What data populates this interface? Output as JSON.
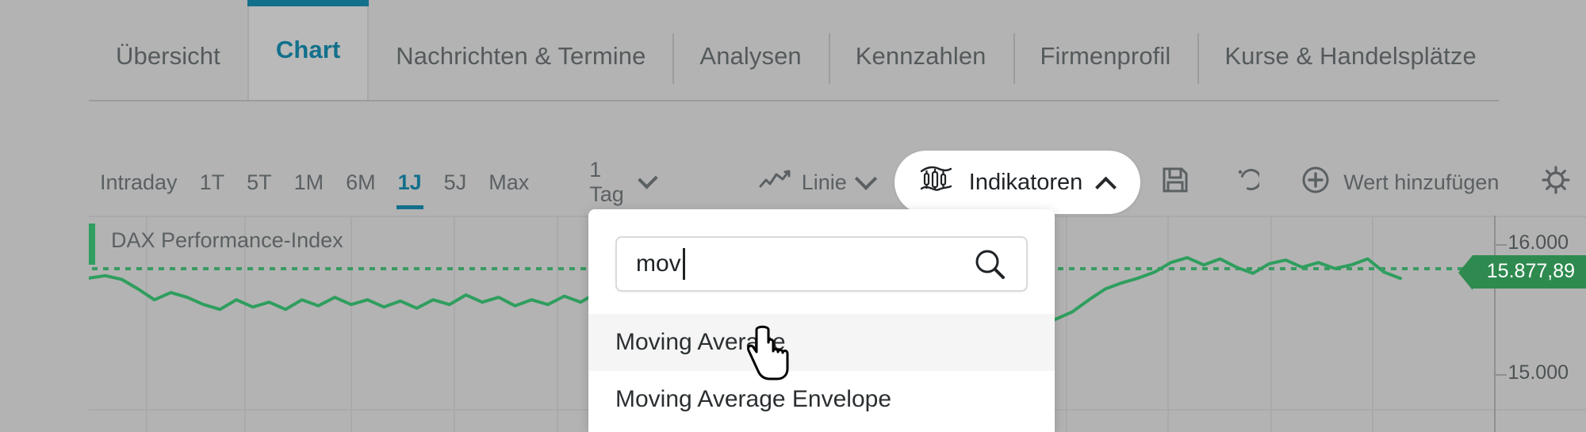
{
  "tabs": [
    {
      "label": "Übersicht",
      "active": false
    },
    {
      "label": "Chart",
      "active": true
    },
    {
      "label": "Nachrichten & Termine",
      "active": false
    },
    {
      "label": "Analysen",
      "active": false
    },
    {
      "label": "Kennzahlen",
      "active": false
    },
    {
      "label": "Firmenprofil",
      "active": false
    },
    {
      "label": "Kurse & Handelsplätze",
      "active": false
    }
  ],
  "toolbar": {
    "ranges": [
      {
        "label": "Intraday",
        "active": false
      },
      {
        "label": "1T",
        "active": false
      },
      {
        "label": "5T",
        "active": false
      },
      {
        "label": "1M",
        "active": false
      },
      {
        "label": "6M",
        "active": false
      },
      {
        "label": "1J",
        "active": true
      },
      {
        "label": "5J",
        "active": false
      },
      {
        "label": "Max",
        "active": false
      }
    ],
    "interval_label": "1 Tag",
    "chart_type_label": "Linie",
    "indicators_label": "Indikatoren",
    "add_value_label": "Wert hinzufügen",
    "save_title": "Speichern",
    "reset_title": "Zurücksetzen",
    "settings_title": "Einstellungen"
  },
  "indicator_search": {
    "value": "mov",
    "placeholder": "",
    "results": [
      {
        "label": "Moving Average",
        "hovered": true
      },
      {
        "label": "Moving Average Envelope",
        "hovered": false
      }
    ]
  },
  "chart_data": {
    "type": "line",
    "title": "DAX Performance-Index",
    "series_name": "DAX Performance-Index",
    "last_price": "15.877,89",
    "line_color": "#2f9e5e",
    "reference_line_color": "#3a9a63",
    "xlabel": "",
    "ylabel": "",
    "y_ticks": [
      "16.000",
      "15.000"
    ],
    "ylim": [
      14600,
      16400
    ],
    "grid": true,
    "legend": "DAX Performance-Index",
    "x": [
      0,
      1,
      2,
      3,
      4,
      5,
      6,
      7,
      8,
      9,
      10,
      11,
      12,
      13,
      14,
      15,
      16,
      17,
      18,
      19,
      20,
      21,
      22,
      23,
      24,
      25,
      26,
      27,
      28,
      29,
      30,
      31,
      32,
      33,
      34,
      35,
      36,
      37,
      38,
      39,
      40,
      41,
      42,
      43,
      44,
      45,
      46,
      47,
      48,
      49,
      50,
      51,
      52,
      53,
      54,
      55,
      56,
      57,
      58,
      59,
      60,
      61,
      62,
      63,
      64,
      65,
      66,
      67,
      68,
      69,
      70,
      71,
      72,
      73,
      74,
      75,
      76,
      77,
      78,
      79,
      80
    ],
    "values": [
      15880,
      15900,
      15870,
      15790,
      15700,
      15760,
      15720,
      15660,
      15620,
      15700,
      15640,
      15680,
      15620,
      15700,
      15650,
      15720,
      15660,
      15700,
      15640,
      15690,
      15630,
      15700,
      15660,
      15740,
      15680,
      15720,
      15650,
      15700,
      15660,
      15730,
      15680,
      15760,
      15700,
      15620,
      15680,
      15740,
      15700,
      15660,
      15720,
      15680,
      15740,
      15800,
      15830,
      15810,
      15780,
      15690,
      15520,
      15330,
      15180,
      15120,
      15280,
      15420,
      15500,
      15460,
      15520,
      15480,
      15560,
      15520,
      15490,
      15540,
      15600,
      15700,
      15790,
      15840,
      15880,
      15930,
      16010,
      16050,
      15990,
      16040,
      15970,
      15920,
      16000,
      16030,
      15970,
      16010,
      15960,
      15990,
      16040,
      15930,
      15878
    ]
  }
}
